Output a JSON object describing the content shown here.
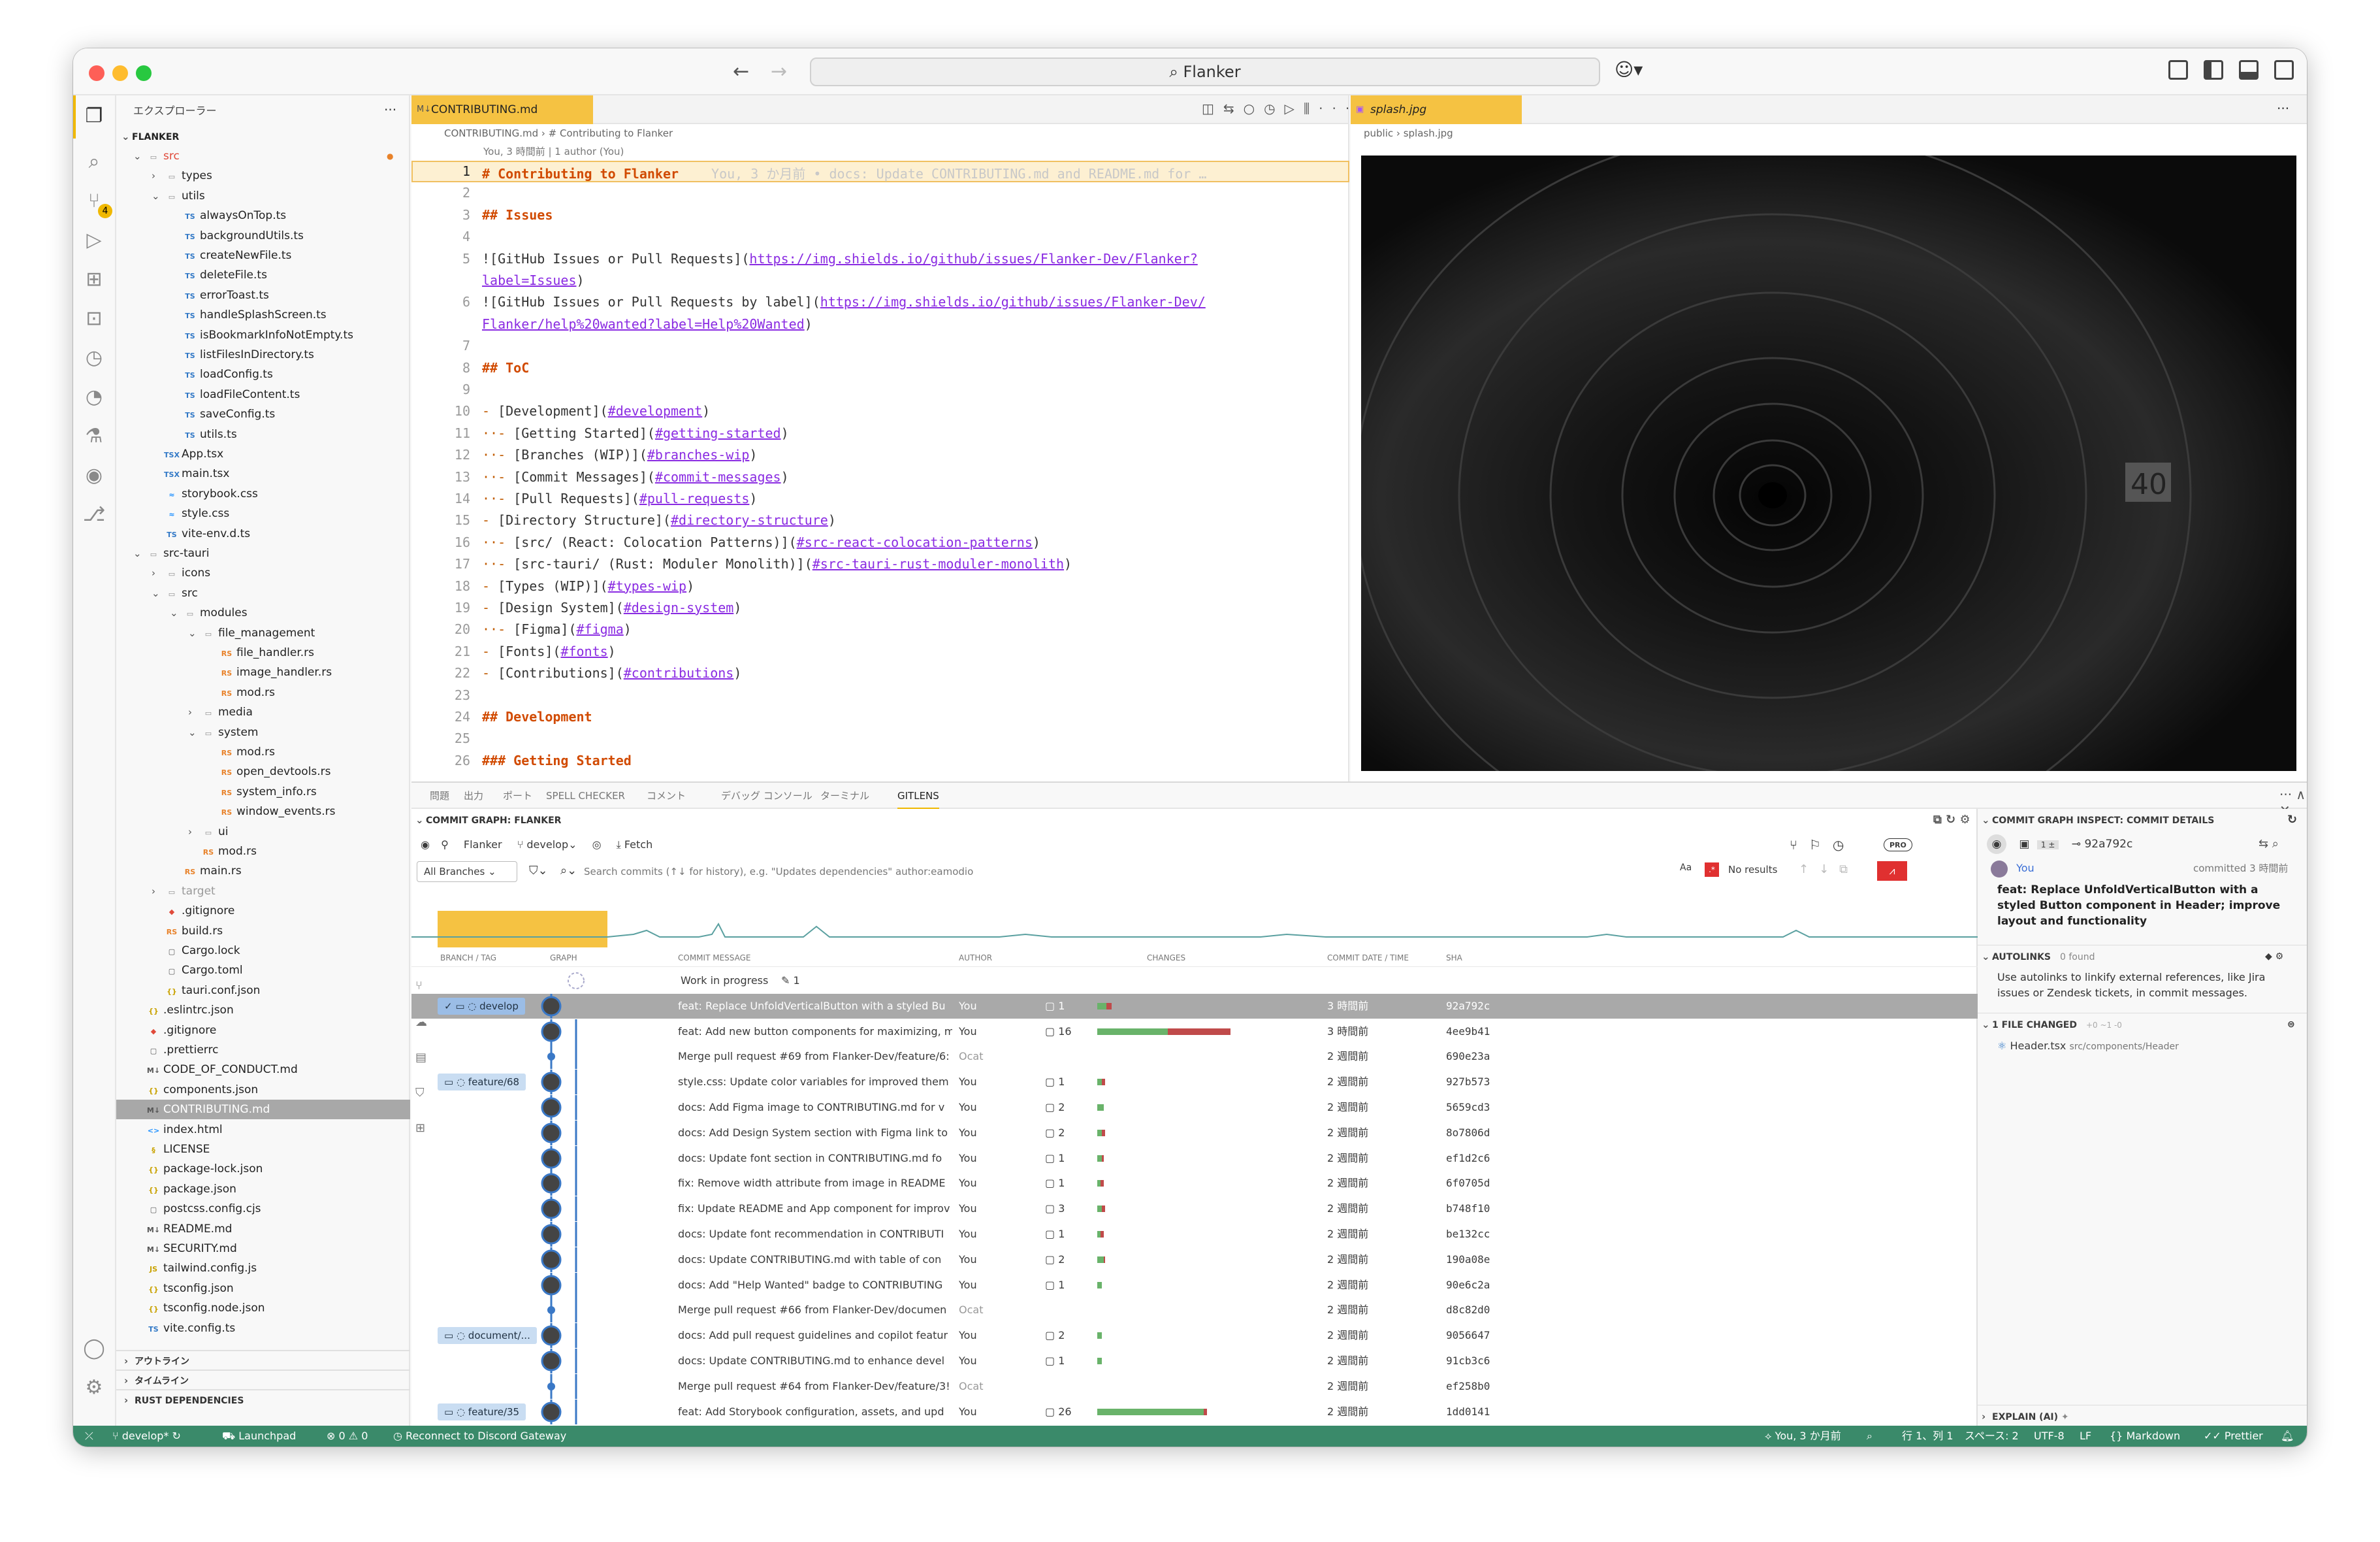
{
  "window": {
    "search": "Flanker"
  },
  "sidebar": {
    "title": "エクスプローラー",
    "root": "FLANKER",
    "sections": [
      "アウトライン",
      "タイムライン",
      "RUST DEPENDENCIES"
    ],
    "tree": [
      {
        "d": 0,
        "t": "folder",
        "n": "src",
        "open": true,
        "red": true
      },
      {
        "d": 1,
        "t": "folder",
        "n": "types",
        "open": false
      },
      {
        "d": 1,
        "t": "folder",
        "n": "utils",
        "open": true
      },
      {
        "d": 2,
        "t": "ts",
        "n": "alwaysOnTop.ts"
      },
      {
        "d": 2,
        "t": "ts",
        "n": "backgroundUtils.ts"
      },
      {
        "d": 2,
        "t": "ts",
        "n": "createNewFile.ts"
      },
      {
        "d": 2,
        "t": "ts",
        "n": "deleteFile.ts"
      },
      {
        "d": 2,
        "t": "ts",
        "n": "errorToast.ts"
      },
      {
        "d": 2,
        "t": "ts",
        "n": "handleSplashScreen.ts"
      },
      {
        "d": 2,
        "t": "ts",
        "n": "isBookmarkInfoNotEmpty.ts"
      },
      {
        "d": 2,
        "t": "ts",
        "n": "listFilesInDirectory.ts"
      },
      {
        "d": 2,
        "t": "ts",
        "n": "loadConfig.ts"
      },
      {
        "d": 2,
        "t": "ts",
        "n": "loadFileContent.ts"
      },
      {
        "d": 2,
        "t": "ts",
        "n": "saveConfig.ts"
      },
      {
        "d": 2,
        "t": "ts",
        "n": "utils.ts"
      },
      {
        "d": 1,
        "t": "tsx",
        "n": "App.tsx"
      },
      {
        "d": 1,
        "t": "tsx",
        "n": "main.tsx"
      },
      {
        "d": 1,
        "t": "css",
        "n": "storybook.css"
      },
      {
        "d": 1,
        "t": "css",
        "n": "style.css"
      },
      {
        "d": 1,
        "t": "ts",
        "n": "vite-env.d.ts"
      },
      {
        "d": 0,
        "t": "folder",
        "n": "src-tauri",
        "open": true
      },
      {
        "d": 1,
        "t": "folder",
        "n": "icons",
        "open": false
      },
      {
        "d": 1,
        "t": "folder",
        "n": "src",
        "open": true
      },
      {
        "d": 2,
        "t": "folder",
        "n": "modules",
        "open": true
      },
      {
        "d": 3,
        "t": "folder",
        "n": "file_management",
        "open": true
      },
      {
        "d": 4,
        "t": "rs",
        "n": "file_handler.rs"
      },
      {
        "d": 4,
        "t": "rs",
        "n": "image_handler.rs"
      },
      {
        "d": 4,
        "t": "rs",
        "n": "mod.rs"
      },
      {
        "d": 3,
        "t": "folder",
        "n": "media",
        "open": false
      },
      {
        "d": 3,
        "t": "folder",
        "n": "system",
        "open": true
      },
      {
        "d": 4,
        "t": "rs",
        "n": "mod.rs"
      },
      {
        "d": 4,
        "t": "rs",
        "n": "open_devtools.rs"
      },
      {
        "d": 4,
        "t": "rs",
        "n": "system_info.rs"
      },
      {
        "d": 4,
        "t": "rs",
        "n": "window_events.rs"
      },
      {
        "d": 3,
        "t": "folder",
        "n": "ui",
        "open": false
      },
      {
        "d": 3,
        "t": "rs",
        "n": "mod.rs"
      },
      {
        "d": 2,
        "t": "rs",
        "n": "main.rs"
      },
      {
        "d": 1,
        "t": "folder",
        "n": "target",
        "open": false
      },
      {
        "d": 1,
        "t": "git",
        "n": ".gitignore"
      },
      {
        "d": 1,
        "t": "rs",
        "n": "build.rs"
      },
      {
        "d": 1,
        "t": "lock",
        "n": "Cargo.lock"
      },
      {
        "d": 1,
        "t": "lock",
        "n": "Cargo.toml"
      },
      {
        "d": 1,
        "t": "json",
        "n": "tauri.conf.json"
      },
      {
        "d": 0,
        "t": "json",
        "n": ".eslintrc.json"
      },
      {
        "d": 0,
        "t": "git",
        "n": ".gitignore"
      },
      {
        "d": 0,
        "t": "lock",
        "n": ".prettierrc"
      },
      {
        "d": 0,
        "t": "md",
        "n": "CODE_OF_CONDUCT.md"
      },
      {
        "d": 0,
        "t": "json",
        "n": "components.json"
      },
      {
        "d": 0,
        "t": "md",
        "n": "CONTRIBUTING.md",
        "sel": true
      },
      {
        "d": 0,
        "t": "html",
        "n": "index.html"
      },
      {
        "d": 0,
        "t": "lic",
        "n": "LICENSE"
      },
      {
        "d": 0,
        "t": "json",
        "n": "package-lock.json"
      },
      {
        "d": 0,
        "t": "json",
        "n": "package.json"
      },
      {
        "d": 0,
        "t": "lock",
        "n": "postcss.config.cjs"
      },
      {
        "d": 0,
        "t": "md",
        "n": "README.md"
      },
      {
        "d": 0,
        "t": "md",
        "n": "SECURITY.md"
      },
      {
        "d": 0,
        "t": "js",
        "n": "tailwind.config.js"
      },
      {
        "d": 0,
        "t": "json",
        "n": "tsconfig.json"
      },
      {
        "d": 0,
        "t": "json",
        "n": "tsconfig.node.json"
      },
      {
        "d": 0,
        "t": "ts",
        "n": "vite.config.ts"
      }
    ]
  },
  "editor1": {
    "tab": "CONTRIBUTING.md",
    "crumb_file": "CONTRIBUTING.md",
    "crumb_sym": "# Contributing to Flanker",
    "blame": "You, 3 時間前 | 1 author (You)",
    "inline_blame": "You, 3 か月前 • docs: Update CONTRIBUTING.md and README.md for …",
    "lines": [
      [
        {
          "c": "h",
          "t": "# Contributing to Flanker"
        }
      ],
      [],
      [
        {
          "c": "h",
          "t": "## Issues"
        }
      ],
      [],
      [
        {
          "c": "",
          "t": "![GitHub Issues or Pull Requests]("
        },
        {
          "c": "lk",
          "t": "https://img.shields.io/github/issues/Flanker-Dev/Flanker?"
        },
        {
          "c": "",
          "t": ""
        }
      ],
      [
        {
          "c": "lk",
          "t": "label=Issues"
        },
        {
          "c": "",
          "t": ")"
        }
      ],
      [
        {
          "c": "",
          "t": "![GitHub Issues or Pull Requests by label]("
        },
        {
          "c": "lk",
          "t": "https://img.shields.io/github/issues/Flanker-Dev/"
        }
      ],
      [
        {
          "c": "lk",
          "t": "Flanker/help%20wanted?label=Help%20Wanted"
        },
        {
          "c": "",
          "t": ")"
        }
      ],
      [],
      [
        {
          "c": "h",
          "t": "## ToC"
        }
      ],
      [],
      [
        {
          "c": "br",
          "t": "- "
        },
        {
          "c": "",
          "t": "[Development]("
        },
        {
          "c": "lk",
          "t": "#development"
        },
        {
          "c": "",
          "t": ")"
        }
      ],
      [
        {
          "c": "br",
          "t": "··- "
        },
        {
          "c": "",
          "t": "[Getting Started]("
        },
        {
          "c": "lk",
          "t": "#getting-started"
        },
        {
          "c": "",
          "t": ")"
        }
      ],
      [
        {
          "c": "br",
          "t": "··- "
        },
        {
          "c": "",
          "t": "[Branches (WIP)]("
        },
        {
          "c": "lk",
          "t": "#branches-wip"
        },
        {
          "c": "",
          "t": ")"
        }
      ],
      [
        {
          "c": "br",
          "t": "··- "
        },
        {
          "c": "",
          "t": "[Commit Messages]("
        },
        {
          "c": "lk",
          "t": "#commit-messages"
        },
        {
          "c": "",
          "t": ")"
        }
      ],
      [
        {
          "c": "br",
          "t": "··- "
        },
        {
          "c": "",
          "t": "[Pull Requests]("
        },
        {
          "c": "lk",
          "t": "#pull-requests"
        },
        {
          "c": "",
          "t": ")"
        }
      ],
      [
        {
          "c": "br",
          "t": "- "
        },
        {
          "c": "",
          "t": "[Directory Structure]("
        },
        {
          "c": "lk",
          "t": "#directory-structure"
        },
        {
          "c": "",
          "t": ")"
        }
      ],
      [
        {
          "c": "br",
          "t": "··- "
        },
        {
          "c": "",
          "t": "[src/ (React: Colocation Patterns)]("
        },
        {
          "c": "lk",
          "t": "#src-react-colocation-patterns"
        },
        {
          "c": "",
          "t": ")"
        }
      ],
      [
        {
          "c": "br",
          "t": "··- "
        },
        {
          "c": "",
          "t": "[src-tauri/ (Rust: Moduler Monolith)]("
        },
        {
          "c": "lk",
          "t": "#src-tauri-rust-moduler-monolith"
        },
        {
          "c": "",
          "t": ")"
        }
      ],
      [
        {
          "c": "br",
          "t": "- "
        },
        {
          "c": "",
          "t": "[Types (WIP)]("
        },
        {
          "c": "lk",
          "t": "#types-wip"
        },
        {
          "c": "",
          "t": ")"
        }
      ],
      [
        {
          "c": "br",
          "t": "- "
        },
        {
          "c": "",
          "t": "[Design System]("
        },
        {
          "c": "lk",
          "t": "#design-system"
        },
        {
          "c": "",
          "t": ")"
        }
      ],
      [
        {
          "c": "br",
          "t": "··- "
        },
        {
          "c": "",
          "t": "[Figma]("
        },
        {
          "c": "lk",
          "t": "#figma"
        },
        {
          "c": "",
          "t": ")"
        }
      ],
      [
        {
          "c": "br",
          "t": "- "
        },
        {
          "c": "",
          "t": "[Fonts]("
        },
        {
          "c": "lk",
          "t": "#fonts"
        },
        {
          "c": "",
          "t": ")"
        }
      ],
      [
        {
          "c": "br",
          "t": "- "
        },
        {
          "c": "",
          "t": "[Contributions]("
        },
        {
          "c": "lk",
          "t": "#contributions"
        },
        {
          "c": "",
          "t": ")"
        }
      ],
      [],
      [
        {
          "c": "h",
          "t": "## Development"
        }
      ],
      [],
      [
        {
          "c": "h",
          "t": "### Getting Started"
        }
      ]
    ],
    "nums": [
      "1",
      "2",
      "3",
      "4",
      "5",
      "",
      "6",
      "",
      "7",
      "8",
      "9",
      "10",
      "11",
      "12",
      "13",
      "14",
      "15",
      "16",
      "17",
      "18",
      "19",
      "20",
      "21",
      "22",
      "23",
      "24",
      "25",
      "26"
    ]
  },
  "editor2": {
    "tab": "splash.jpg",
    "crumb1": "public",
    "crumb2": "splash.jpg"
  },
  "panel": {
    "tabs": [
      "問題",
      "出力",
      "ポート",
      "SPELL CHECKER",
      "コメント",
      "デバッグ コンソール",
      "ターミナル",
      "GITLENS"
    ]
  },
  "graph": {
    "title": "COMMIT GRAPH: FLANKER",
    "repo": "Flanker",
    "branch": "develop",
    "fetch": "Fetch",
    "filter": "All Branches",
    "search_placeholder": "Search commits (↑↓ for history), e.g. \"Updates dependencies\" author:eamodio",
    "no_results": "No results",
    "pro": "PRO",
    "cols": [
      "BRANCH / TAG",
      "GRAPH",
      "COMMIT MESSAGE",
      "AUTHOR",
      "CHANGES",
      "COMMIT DATE / TIME",
      "SHA"
    ],
    "wip": "Work in progress",
    "wip_count": "1",
    "rows": [
      {
        "tag": "develop",
        "msg": "feat: Replace UnfoldVerticalButton with a styled Bu",
        "author": "You",
        "files": "1",
        "date": "3 時間前",
        "sha": "92a792c",
        "sel": true,
        "g": 6,
        "r": 3
      },
      {
        "msg": "feat: Add new button components for maximizing, m",
        "author": "You",
        "files": "16",
        "date": "3 時間前",
        "sha": "4ee9b41",
        "g": 45,
        "r": 40
      },
      {
        "msg": "Merge pull request #69 from Flanker-Dev/feature/6:",
        "author": "Ocat",
        "files": "",
        "date": "2 週間前",
        "sha": "690e23a"
      },
      {
        "tag": "feature/68",
        "msg": "style.css: Update color variables for improved them",
        "author": "You",
        "files": "1",
        "date": "2 週間前",
        "sha": "927b573",
        "g": 3,
        "r": 2
      },
      {
        "msg": "docs: Add Figma image to CONTRIBUTING.md for v",
        "author": "You",
        "files": "2",
        "date": "2 週間前",
        "sha": "5659cd3",
        "g": 4,
        "r": 0
      },
      {
        "msg": "docs: Add Design System section with Figma link to",
        "author": "You",
        "files": "2",
        "date": "2 週間前",
        "sha": "8o7806d",
        "g": 3,
        "r": 2
      },
      {
        "msg": "docs: Update font section in CONTRIBUTING.md fo",
        "author": "You",
        "files": "1",
        "date": "2 週間前",
        "sha": "ef1d2c6",
        "g": 3,
        "r": 1
      },
      {
        "msg": "fix: Remove width attribute from image in README",
        "author": "You",
        "files": "1",
        "date": "2 週間前",
        "sha": "6f0705d",
        "g": 2,
        "r": 2
      },
      {
        "msg": "fix: Update README and App component for improv",
        "author": "You",
        "files": "3",
        "date": "2 週間前",
        "sha": "b748f10",
        "g": 3,
        "r": 2
      },
      {
        "msg": "docs: Update font recommendation in CONTRIBUTI",
        "author": "You",
        "files": "1",
        "date": "2 週間前",
        "sha": "be132cc",
        "g": 2,
        "r": 2
      },
      {
        "msg": "docs: Update CONTRIBUTING.md with table of con",
        "author": "You",
        "files": "2",
        "date": "2 週間前",
        "sha": "190a08e",
        "g": 4,
        "r": 1
      },
      {
        "msg": "docs: Add \"Help Wanted\" badge to CONTRIBUTING",
        "author": "You",
        "files": "1",
        "date": "2 週間前",
        "sha": "90e6c2a",
        "g": 3,
        "r": 0
      },
      {
        "msg": "Merge pull request #66 from Flanker-Dev/documen",
        "author": "Ocat",
        "files": "",
        "date": "2 週間前",
        "sha": "d8c82d0"
      },
      {
        "tag": "document/...",
        "msg": "docs: Add pull request guidelines and copilot featur",
        "author": "You",
        "files": "2",
        "date": "2 週間前",
        "sha": "9056647",
        "g": 3,
        "r": 0
      },
      {
        "msg": "docs: Update CONTRIBUTING.md to enhance devel",
        "author": "You",
        "files": "1",
        "date": "2 週間前",
        "sha": "91cb3c6",
        "g": 3,
        "r": 0
      },
      {
        "msg": "Merge pull request #64 from Flanker-Dev/feature/3!",
        "author": "Ocat",
        "files": "",
        "date": "2 週間前",
        "sha": "ef258b0"
      },
      {
        "tag": "feature/35",
        "msg": "feat: Add Storybook configuration, assets, and upd",
        "author": "You",
        "files": "26",
        "date": "2 週間前",
        "sha": "1dd0141",
        "g": 68,
        "r": 2
      }
    ]
  },
  "inspect": {
    "title": "COMMIT GRAPH INSPECT: COMMIT DETAILS",
    "sha": "92a792c",
    "author": "You",
    "when": "committed 3 時間前",
    "message": "feat: Replace UnfoldVerticalButton with a styled Button component in Header; improve layout and functionality",
    "autolinks": "AUTOLINKS",
    "autolinks_count": "0 found",
    "autolinks_text": "Use autolinks to linkify external references, like Jira issues or Zendesk tickets, in commit messages.",
    "changed": "1 FILE CHANGED",
    "changed_stats": "+0 ~1 -0",
    "file": "Header.tsx",
    "file_path": "src/components/Header",
    "explain": "EXPLAIN (AI)"
  },
  "status": {
    "branch": "develop*",
    "launchpad": "Launchpad",
    "problems": "⊗ 0 ⚠ 0",
    "discord": "Reconnect to Discord Gateway",
    "blame": "You, 3 か月前",
    "pos": "行 1、列 1",
    "spaces": "スペース: 2",
    "enc": "UTF-8",
    "eol": "LF",
    "lang": "Markdown",
    "prettier": "Prettier"
  }
}
